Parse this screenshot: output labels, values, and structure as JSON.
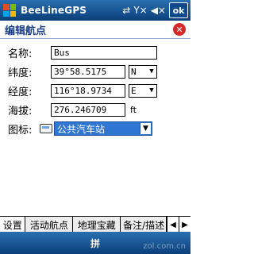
{
  "status_bar": {
    "app_title": "BeeLineGPS",
    "ok_label": "ok",
    "icons": [
      "windows-logo",
      "network-icon",
      "signal-off-icon",
      "volume-icon"
    ]
  },
  "header": {
    "title": "编辑航点",
    "close_icon": "close-icon"
  },
  "form": {
    "name": {
      "label": "名称:",
      "value": "Bus"
    },
    "latitude": {
      "label": "纬度:",
      "value": "39°58.5175",
      "dir": "N"
    },
    "longitude": {
      "label": "经度:",
      "value": "116°18.9734",
      "dir": "E"
    },
    "altitude": {
      "label": "海拔:",
      "value": "276.246709",
      "unit": "ft"
    },
    "icon": {
      "label": "图标:",
      "value": "公共汽车站"
    }
  },
  "tabs": [
    {
      "label": "设置"
    },
    {
      "label": "活动航点"
    },
    {
      "label": "地理宝藏"
    },
    {
      "label": "备注/描述"
    }
  ],
  "bottom_bar": {
    "ime_label": "拼"
  },
  "watermark": "zol.com.cn",
  "colors": {
    "bar_top": "#2a6fb0",
    "bar_bottom": "#0b3f7a",
    "title": "#1b3e86",
    "selection": "#2f77d3",
    "close": "#d62828"
  }
}
